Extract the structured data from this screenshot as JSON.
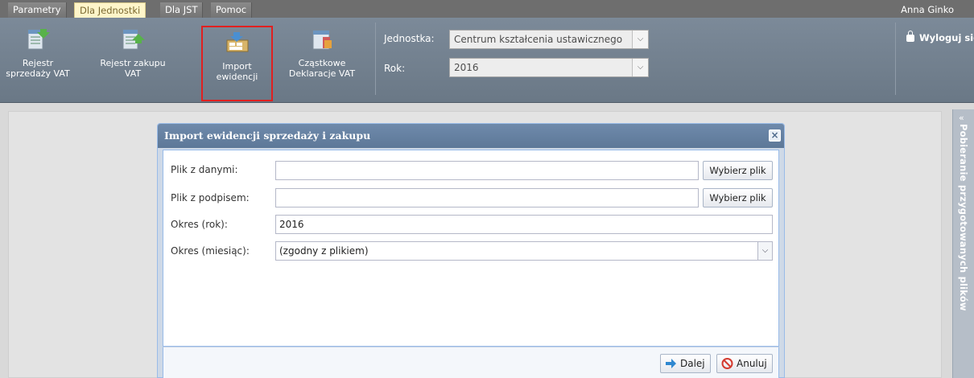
{
  "menu": {
    "tabs": [
      "Parametry",
      "Dla Jednostki",
      "Dla JST",
      "Pomoc"
    ],
    "user": "Anna Ginko"
  },
  "ribbon": {
    "buttons": [
      {
        "line1": "Rejestr",
        "line2": "sprzedaży VAT",
        "icon": "vat-register-sales-icon"
      },
      {
        "line1": "Rejestr zakupu",
        "line2": "VAT",
        "icon": "vat-register-purchase-icon"
      },
      {
        "line1": "Import",
        "line2": "ewidencji",
        "icon": "import-records-icon"
      },
      {
        "line1": "Cząstkowe",
        "line2": "Deklaracje VAT",
        "icon": "partial-declarations-icon"
      }
    ],
    "jednostka_label": "Jednostka:",
    "jednostka_value": "Centrum kształcenia ustawicznego",
    "rok_label": "Rok:",
    "rok_value": "2016",
    "logout_label": "Wyloguj się"
  },
  "side_panel": {
    "title": "Pobieranie przygotowanych plików"
  },
  "dialog": {
    "title": "Import ewidencji sprzedaży i zakupu",
    "fields": {
      "data_file_label": "Plik z danymi:",
      "signature_file_label": "Plik z podpisem:",
      "year_label": "Okres (rok):",
      "year_value": "2016",
      "month_label": "Okres (miesiąc):",
      "month_value": "(zgodny z plikiem)",
      "choose_file_label": "Wybierz plik"
    },
    "next_label": "Dalej",
    "cancel_label": "Anuluj"
  },
  "colors": {
    "accent": "#5d7898",
    "active_tab": "#fff5c9",
    "highlight": "#e02020"
  }
}
